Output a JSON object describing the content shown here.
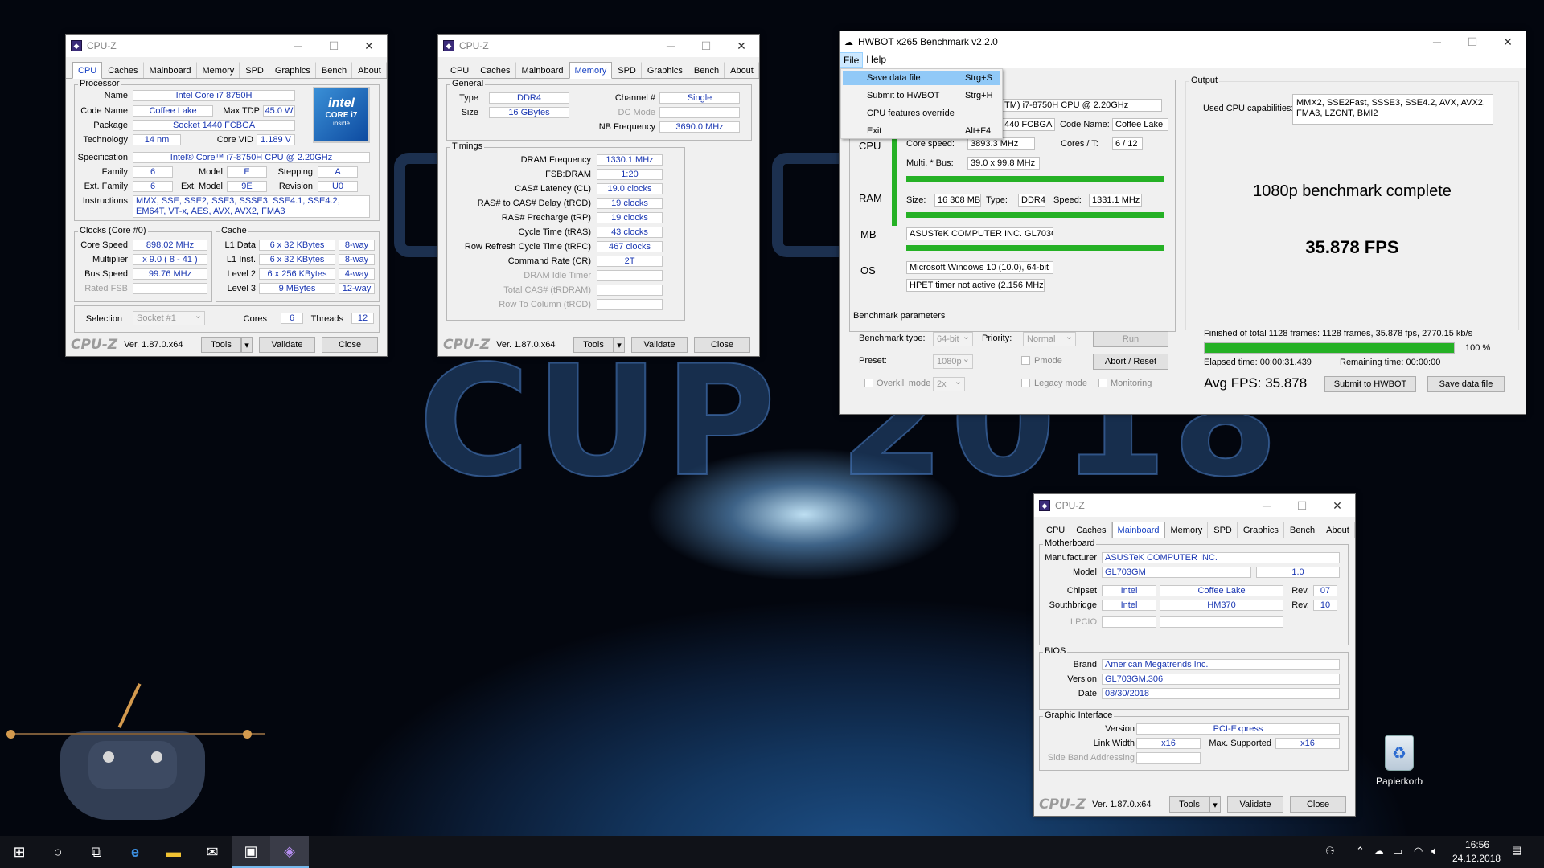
{
  "desktop": {
    "bg_words": [
      "CUP 2018"
    ],
    "recycle_label": "Papierkorb"
  },
  "cpuz_common": {
    "title": "CPU-Z",
    "version": "Ver. 1.87.0.x64",
    "tools": "Tools",
    "validate": "Validate",
    "close": "Close",
    "logo": "CPU-Z",
    "tabs": [
      "CPU",
      "Caches",
      "Mainboard",
      "Memory",
      "SPD",
      "Graphics",
      "Bench",
      "About"
    ]
  },
  "cpu_tab": {
    "processor": "Processor",
    "name_l": "Name",
    "name": "Intel Core i7 8750H",
    "code_l": "Code Name",
    "code": "Coffee Lake",
    "tdp_l": "Max TDP",
    "tdp": "45.0 W",
    "pkg_l": "Package",
    "pkg": "Socket 1440 FCBGA",
    "tech_l": "Technology",
    "tech": "14 nm",
    "vid_l": "Core VID",
    "vid": "1.189 V",
    "spec_l": "Specification",
    "spec": "Intel® Core™ i7-8750H CPU @ 2.20GHz",
    "fam_l": "Family",
    "fam": "6",
    "model_l": "Model",
    "model": "E",
    "step_l": "Stepping",
    "step": "A",
    "efam_l": "Ext. Family",
    "efam": "6",
    "emod_l": "Ext. Model",
    "emod": "9E",
    "rev_l": "Revision",
    "rev": "U0",
    "inst_l": "Instructions",
    "inst": "MMX, SSE, SSE2, SSE3, SSSE3, SSE4.1, SSE4.2, EM64T, VT-x, AES, AVX, AVX2, FMA3",
    "clocks": "Clocks (Core #0)",
    "cs_l": "Core Speed",
    "cs": "898.02 MHz",
    "mul_l": "Multiplier",
    "mul": "x 9.0 ( 8 - 41 )",
    "bus_l": "Bus Speed",
    "bus": "99.76 MHz",
    "fsb_l": "Rated FSB",
    "cache": "Cache",
    "l1d_l": "L1 Data",
    "l1d": "6 x 32 KBytes",
    "l1d_w": "8-way",
    "l1i_l": "L1 Inst.",
    "l1i": "6 x 32 KBytes",
    "l1i_w": "8-way",
    "l2_l": "Level 2",
    "l2": "6 x 256 KBytes",
    "l2_w": "4-way",
    "l3_l": "Level 3",
    "l3": "9 MBytes",
    "l3_w": "12-way",
    "sel_l": "Selection",
    "sel": "Socket #1",
    "cores_l": "Cores",
    "cores": "6",
    "thr_l": "Threads",
    "thr": "12",
    "intel_logo": "intel",
    "intel_sub": "CORE i7",
    "intel_inside": "inside"
  },
  "mem_tab": {
    "general": "General",
    "type_l": "Type",
    "type": "DDR4",
    "size_l": "Size",
    "size": "16 GBytes",
    "chan_l": "Channel #",
    "chan": "Single",
    "dc_l": "DC Mode",
    "nb_l": "NB Frequency",
    "nb": "3690.0 MHz",
    "timings": "Timings",
    "rows": [
      [
        "DRAM Frequency",
        "1330.1 MHz"
      ],
      [
        "FSB:DRAM",
        "1:20"
      ],
      [
        "CAS# Latency (CL)",
        "19.0 clocks"
      ],
      [
        "RAS# to CAS# Delay (tRCD)",
        "19 clocks"
      ],
      [
        "RAS# Precharge (tRP)",
        "19 clocks"
      ],
      [
        "Cycle Time (tRAS)",
        "43 clocks"
      ],
      [
        "Row Refresh Cycle Time (tRFC)",
        "467 clocks"
      ],
      [
        "Command Rate (CR)",
        "2T"
      ]
    ],
    "dis_rows": [
      "DRAM Idle Timer",
      "Total CAS# (tRDRAM)",
      "Row To Column (tRCD)"
    ]
  },
  "mb_tab": {
    "motherboard": "Motherboard",
    "man_l": "Manufacturer",
    "man": "ASUSTeK COMPUTER INC.",
    "model_l": "Model",
    "model": "GL703GM",
    "model_rev": "1.0",
    "chip_l": "Chipset",
    "chip_v": "Intel",
    "chip_n": "Coffee Lake",
    "rev_l": "Rev.",
    "chip_r": "07",
    "sb_l": "Southbridge",
    "sb_v": "Intel",
    "sb_n": "HM370",
    "sb_r": "10",
    "lpcio_l": "LPCIO",
    "bios": "BIOS",
    "brand_l": "Brand",
    "brand": "American Megatrends Inc.",
    "ver_l": "Version",
    "ver": "GL703GM.306",
    "date_l": "Date",
    "date": "08/30/2018",
    "gi": "Graphic Interface",
    "gver_l": "Version",
    "gver": "PCI-Express",
    "lw_l": "Link Width",
    "lw": "x16",
    "ms_l": "Max. Supported",
    "ms": "x16",
    "sba_l": "Side Band Addressing"
  },
  "hwbot": {
    "title": "HWBOT x265 Benchmark v2.2.0",
    "menu_file": "File",
    "menu_help": "Help",
    "file_menu": [
      {
        "label": "Save data file",
        "key": "Strg+S"
      },
      {
        "label": "Submit to HWBOT",
        "key": "Strg+H"
      },
      {
        "label": "CPU features override",
        "key": ""
      },
      {
        "label": "Exit",
        "key": "Alt+F4"
      }
    ],
    "cpu_name": "TM) i7-8750H CPU @ 2.20GHz",
    "pkg": "440 FCBGA",
    "code_l": "Code Name:",
    "code": "Coffee Lake",
    "cs_l": "Core speed:",
    "cs": "3893.3 MHz",
    "ct_l": "Cores / T:",
    "ct": "6 / 12",
    "mb_l": "Multi. * Bus:",
    "mb": "39.0 x 99.8 MHz",
    "cpu_h": "CPU",
    "ram_h": "RAM",
    "mb_h": "MB",
    "os_h": "OS",
    "size_l": "Size:",
    "size": "16 308 MB",
    "type_l": "Type:",
    "type": "DDR4",
    "spd_l": "Speed:",
    "spd": "1331.1 MHz",
    "board": "ASUSTeK COMPUTER INC. GL703GM",
    "os": "Microsoft Windows 10 (10.0), 64-bit",
    "hpet": "HPET timer not active (2.156 MHz)",
    "output": "Output",
    "caps_l": "Used CPU capabilities:",
    "caps": "MMX2, SSE2Fast, SSSE3, SSE4.2, AVX, AVX2, FMA3, LZCNT, BMI2",
    "complete": "1080p benchmark complete",
    "fps": "35.878 FPS",
    "params": "Benchmark parameters",
    "bt_l": "Benchmark type:",
    "bt": "64-bit",
    "prio_l": "Priority:",
    "prio": "Normal",
    "run": "Run",
    "preset_l": "Preset:",
    "preset": "1080p",
    "pmode": "Pmode",
    "abort": "Abort / Reset",
    "overkill": "Overkill mode",
    "ok_val": "2x",
    "legacy": "Legacy mode",
    "monitoring": "Monitoring",
    "finished": "Finished of total 1128 frames: 1128 frames, 35.878 fps,   2770.15 kb/s",
    "progress": 1.0,
    "pct": "100 %",
    "elapsed": "Elapsed time: 00:00:31.439",
    "remaining": "Remaining time: 00:00:00",
    "avg": "Avg FPS: 35.878",
    "submit": "Submit to HWBOT",
    "save": "Save data file"
  },
  "taskbar": {
    "time": "16:56",
    "date": "24.12.2018"
  },
  "colors": {
    "accent": "#1a37b2",
    "progress": "#25b125",
    "taskbar": "#101218"
  }
}
